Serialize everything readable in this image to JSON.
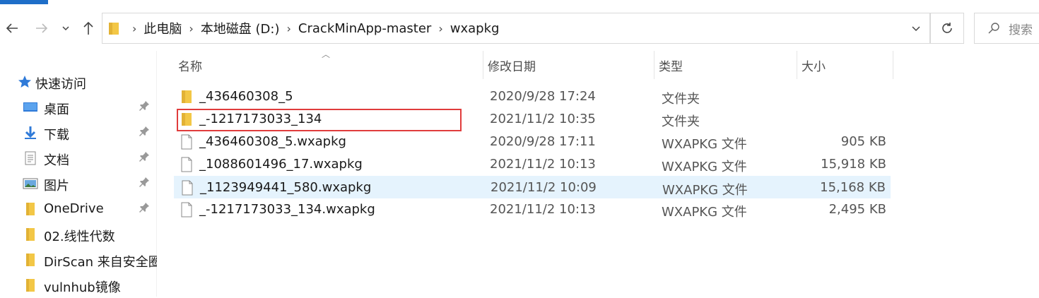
{
  "address": {
    "crumbs": [
      "此电脑",
      "本地磁盘 (D:)",
      "CrackMinApp-master",
      "wxapkg"
    ]
  },
  "search": {
    "placeholder": "搜索"
  },
  "nav": {
    "quick_access": "快速访问",
    "items": [
      {
        "label": "桌面",
        "icon": "desktop-icon",
        "pinned": true
      },
      {
        "label": "下载",
        "icon": "download-icon",
        "pinned": true
      },
      {
        "label": "文档",
        "icon": "document-icon",
        "pinned": true
      },
      {
        "label": "图片",
        "icon": "pictures-icon",
        "pinned": true
      },
      {
        "label": "OneDrive",
        "icon": "folder-icon",
        "pinned": true
      },
      {
        "label": "02.线性代数",
        "icon": "folder-icon",
        "pinned": false
      },
      {
        "label": "DirScan 来自安全圈",
        "icon": "folder-icon",
        "pinned": false
      },
      {
        "label": "vulnhub镜像",
        "icon": "folder-icon",
        "pinned": false
      }
    ]
  },
  "columns": {
    "name": "名称",
    "date": "修改日期",
    "type": "类型",
    "size": "大小"
  },
  "files": [
    {
      "name": "_436460308_5",
      "date": "2020/9/28 17:24",
      "type": "文件夹",
      "size": "",
      "kind": "folder"
    },
    {
      "name": "_-1217173033_134",
      "date": "2021/11/2 10:35",
      "type": "文件夹",
      "size": "",
      "kind": "folder"
    },
    {
      "name": "_436460308_5.wxapkg",
      "date": "2020/9/28 17:11",
      "type": "WXAPKG 文件",
      "size": "905 KB",
      "kind": "file"
    },
    {
      "name": "_1088601496_17.wxapkg",
      "date": "2021/11/2 10:13",
      "type": "WXAPKG 文件",
      "size": "15,918 KB",
      "kind": "file"
    },
    {
      "name": "_1123949441_580.wxapkg",
      "date": "2021/11/2 10:09",
      "type": "WXAPKG 文件",
      "size": "15,168 KB",
      "kind": "file"
    },
    {
      "name": "_-1217173033_134.wxapkg",
      "date": "2021/11/2 10:13",
      "type": "WXAPKG 文件",
      "size": "2,495 KB",
      "kind": "file"
    }
  ],
  "colors": {
    "folder": "#f3c746",
    "selection": "#e5f3fd",
    "highlight_box": "#e03c3c",
    "accent": "#1e6ec8"
  }
}
